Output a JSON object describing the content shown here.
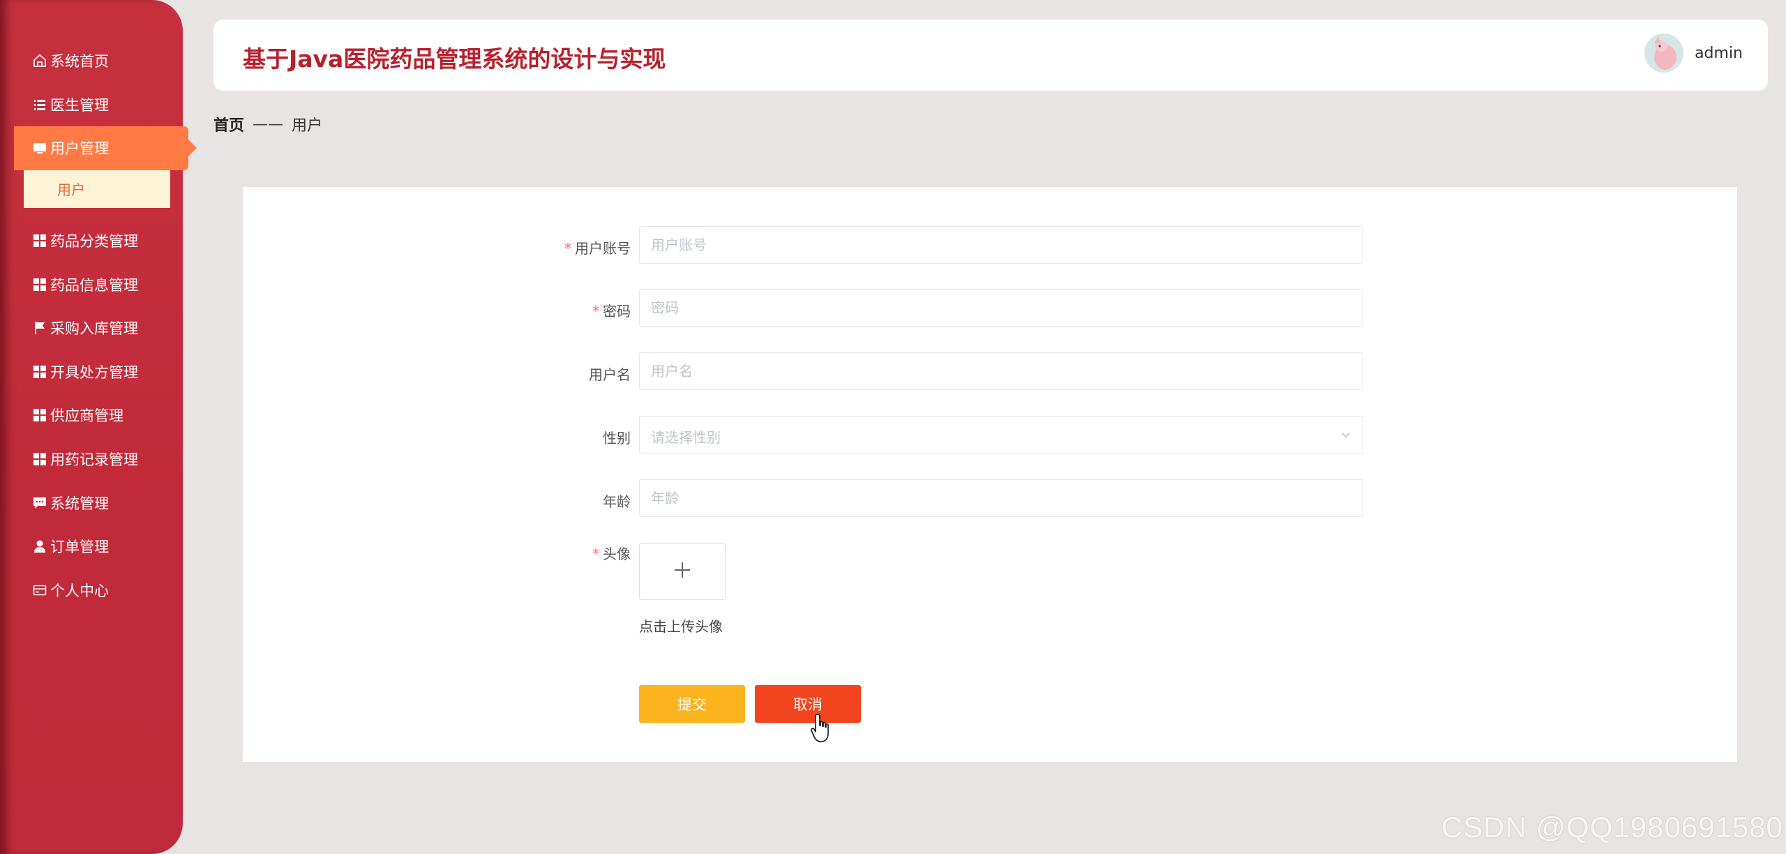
{
  "sidebar": {
    "items": [
      {
        "label": "系统首页",
        "icon": "home-icon"
      },
      {
        "label": "医生管理",
        "icon": "list-icon"
      },
      {
        "label": "用户管理",
        "icon": "monitor-icon",
        "active": true,
        "children": [
          {
            "label": "用户"
          }
        ]
      },
      {
        "label": "药品分类管理",
        "icon": "grid-icon"
      },
      {
        "label": "药品信息管理",
        "icon": "grid-icon"
      },
      {
        "label": "采购入库管理",
        "icon": "flag-icon"
      },
      {
        "label": "开具处方管理",
        "icon": "grid-icon"
      },
      {
        "label": "供应商管理",
        "icon": "grid-icon"
      },
      {
        "label": "用药记录管理",
        "icon": "grid-icon"
      },
      {
        "label": "系统管理",
        "icon": "chat-icon"
      },
      {
        "label": "订单管理",
        "icon": "user-icon"
      },
      {
        "label": "个人中心",
        "icon": "card-icon"
      }
    ]
  },
  "header": {
    "title": "基于Java医院药品管理系统的设计与实现",
    "username": "admin"
  },
  "breadcrumb": {
    "home": "首页",
    "separator": "——",
    "current": "用户"
  },
  "form": {
    "account": {
      "label": "用户账号",
      "placeholder": "用户账号",
      "required": true
    },
    "password": {
      "label": "密码",
      "placeholder": "密码",
      "required": true
    },
    "username": {
      "label": "用户名",
      "placeholder": "用户名",
      "required": false
    },
    "gender": {
      "label": "性别",
      "placeholder": "请选择性别",
      "required": false
    },
    "age": {
      "label": "年龄",
      "placeholder": "年龄",
      "required": false
    },
    "avatar": {
      "label": "头像",
      "tip": "点击上传头像",
      "required": true
    },
    "required_mark": "*",
    "submit_label": "提交",
    "cancel_label": "取消"
  },
  "watermark": "CSDN @QQ1980691580",
  "colors": {
    "sidebar": "#c12a3a",
    "active_item": "#ff7a45",
    "submenu_bg": "#fdf3d7",
    "title": "#b8202e",
    "submit": "#fbb41d",
    "cancel": "#f2441f"
  }
}
